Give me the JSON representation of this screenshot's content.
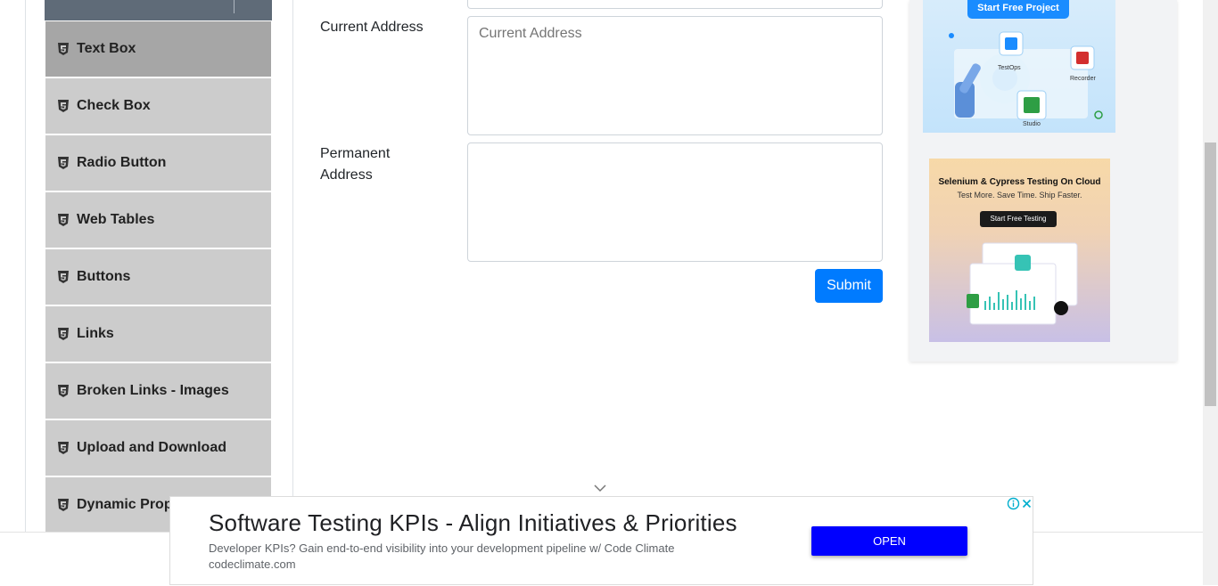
{
  "sidebar": {
    "items": [
      {
        "label": "Text Box",
        "active": true
      },
      {
        "label": "Check Box",
        "active": false
      },
      {
        "label": "Radio Button",
        "active": false
      },
      {
        "label": "Web Tables",
        "active": false
      },
      {
        "label": "Buttons",
        "active": false
      },
      {
        "label": "Links",
        "active": false
      },
      {
        "label": "Broken Links - Images",
        "active": false
      },
      {
        "label": "Upload and Download",
        "active": false
      },
      {
        "label": "Dynamic Properties",
        "active": false
      }
    ]
  },
  "form": {
    "current_address_label": "Current Address",
    "current_address_placeholder": "Current Address",
    "current_address_value": "",
    "permanent_address_label": "Permanent Address",
    "permanent_address_value": "",
    "submit_label": "Submit"
  },
  "ads": {
    "ad1": {
      "button": "Start Free Project",
      "labels": [
        "TestOps",
        "Recorder",
        "Studio"
      ]
    },
    "ad2": {
      "title": "Selenium & Cypress Testing On Cloud",
      "subtitle": "Test More. Save Time. Ship Faster.",
      "button": "Start Free Testing"
    }
  },
  "banner": {
    "title": "Software Testing KPIs - Align Initiatives & Priorities",
    "description": "Developer KPIs? Gain end-to-end visibility into your development pipeline w/ Code Climate",
    "url": "codeclimate.com",
    "cta": "OPEN"
  },
  "colors": {
    "primary": "#007bff",
    "sidebar_bg": "#cccccc",
    "sidebar_active": "#a6a6a6",
    "banner_cta": "#0000ff"
  }
}
